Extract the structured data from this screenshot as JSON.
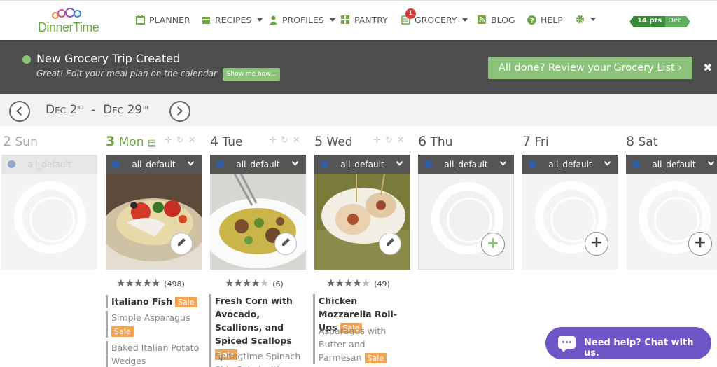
{
  "app": {
    "logo_text": "DinnerTime"
  },
  "nav": {
    "planner": "PLANNER",
    "recipes": "RECIPES",
    "profiles": "PROFILES",
    "pantry": "PANTRY",
    "grocery": "GROCERY",
    "grocery_badge": "1",
    "blog": "BLOG",
    "help": "HELP",
    "points": "14 pts",
    "points_month": "Dec"
  },
  "banner": {
    "title": "New Grocery Trip Created",
    "subtitle": "Great! Edit your meal plan on the calendar",
    "show_me": "Show me how...",
    "review": "All done? Review your Grocery List ›",
    "close": "✖"
  },
  "dates": {
    "start": "Dec 2",
    "start_suffix": "nd",
    "separator": "-",
    "end": "Dec 29",
    "end_suffix": "th"
  },
  "days": [
    {
      "num": "2",
      "name": "Sun",
      "profile": "all_default"
    },
    {
      "num": "3",
      "name": "Mon",
      "profile": "all_default"
    },
    {
      "num": "4",
      "name": "Tue",
      "profile": "all_default"
    },
    {
      "num": "5",
      "name": "Wed",
      "profile": "all_default"
    },
    {
      "num": "6",
      "name": "Thu",
      "profile": "all_default"
    },
    {
      "num": "7",
      "name": "Fri",
      "profile": "all_default"
    },
    {
      "num": "8",
      "name": "Sat",
      "profile": "all_default"
    }
  ],
  "meals": {
    "mon": {
      "rating_count": "(498)",
      "main": "Italiano Fish",
      "side1": "Simple Asparagus",
      "side2": "Baked Italian Potato Wedges"
    },
    "tue": {
      "rating_count": "(6)",
      "main": "Fresh Corn with Avocado, Scallions, and Spiced Scallops",
      "side1": "Springtime Spinach Side Salad with"
    },
    "wed": {
      "rating_count": "(49)",
      "main": "Chicken Mozzarella Roll-Ups",
      "side1": "Asparagus with Butter and Parmesan"
    }
  },
  "sale_label": "Sale",
  "chat": {
    "label": "Need help? Chat with us."
  },
  "colors": {
    "brand_green": "#8cc37a",
    "banner_bg": "#4d4d4d",
    "sale": "#f2a654",
    "chat": "#6f56c7"
  }
}
